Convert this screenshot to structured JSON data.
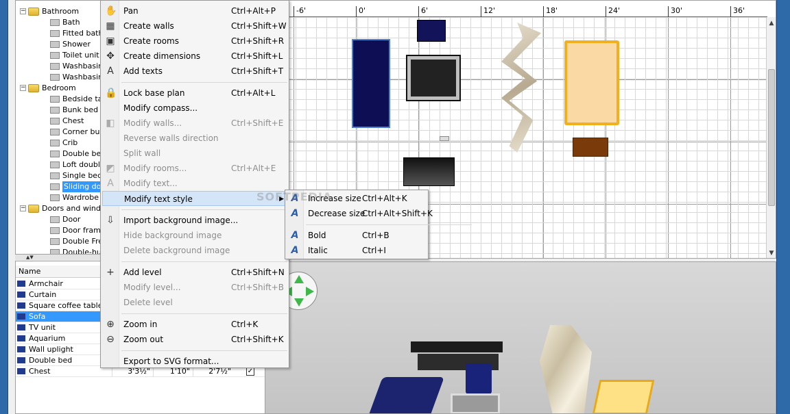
{
  "catalog": {
    "categories": [
      {
        "label": "Bathroom",
        "toggle": "−",
        "items": [
          "Bath",
          "Fitted bath",
          "Shower",
          "Toilet unit",
          "Washbasin",
          "Washbasin"
        ]
      },
      {
        "label": "Bedroom",
        "toggle": "−",
        "items": [
          "Bedside tab",
          "Bunk bed",
          "Chest",
          "Corner bun",
          "Crib",
          "Double bed",
          "Loft double",
          "Single bed",
          "Sliding door",
          "Wardrobe"
        ]
      },
      {
        "label": "Doors and wind",
        "toggle": "−",
        "items": [
          "Door",
          "Door frame",
          "Double Fre",
          "Double-hun"
        ]
      }
    ],
    "selected_item": "Sliding door"
  },
  "splitter_arrows": "▲▼",
  "furniture": {
    "column_name": "Name",
    "rows": [
      {
        "name": "Armchair"
      },
      {
        "name": "Curtain"
      },
      {
        "name": "Square coffee table"
      },
      {
        "name": "Sofa",
        "selected": true
      },
      {
        "name": "TV unit"
      },
      {
        "name": "Aquarium"
      },
      {
        "name": "Wall uplight"
      },
      {
        "name": "Double bed"
      },
      {
        "name": "Chest",
        "width": "3'3½\"",
        "depth": "1'10\"",
        "height": "2'7½\"",
        "visible": "✓"
      }
    ]
  },
  "ruler": [
    "-6'",
    "0'",
    "6'",
    "12'",
    "18'",
    "24'",
    "30'",
    "36'"
  ],
  "scroll": {
    "up": "▲",
    "down": "▼"
  },
  "menu": {
    "items": [
      {
        "icon": "✋",
        "icon_name": "pan-hand-icon",
        "label": "Pan",
        "shortcut": "Ctrl+Alt+P",
        "disabled": false
      },
      {
        "icon": "▦",
        "icon_name": "create-walls-icon",
        "label": "Create walls",
        "shortcut": "Ctrl+Shift+W",
        "disabled": false
      },
      {
        "icon": "▣",
        "icon_name": "create-rooms-icon",
        "label": "Create rooms",
        "shortcut": "Ctrl+Shift+R",
        "disabled": false
      },
      {
        "icon": "✥",
        "icon_name": "create-dimensions-icon",
        "label": "Create dimensions",
        "shortcut": "Ctrl+Shift+L",
        "disabled": false
      },
      {
        "icon": "A",
        "icon_name": "add-text-icon",
        "label": "Add texts",
        "shortcut": "Ctrl+Shift+T",
        "disabled": false
      },
      {
        "sep": true
      },
      {
        "icon": "🔒",
        "icon_name": "lock-icon",
        "label": "Lock base plan",
        "shortcut": "Ctrl+Alt+L",
        "disabled": false
      },
      {
        "icon": "",
        "icon_name": "compass-icon",
        "label": "Modify compass...",
        "shortcut": "",
        "disabled": false
      },
      {
        "icon": "◧",
        "icon_name": "modify-walls-icon",
        "label": "Modify walls...",
        "shortcut": "Ctrl+Shift+E",
        "disabled": true
      },
      {
        "icon": "",
        "icon_name": "reverse-walls-icon",
        "label": "Reverse walls direction",
        "shortcut": "",
        "disabled": true
      },
      {
        "icon": "",
        "icon_name": "split-wall-icon",
        "label": "Split wall",
        "shortcut": "",
        "disabled": true
      },
      {
        "icon": "◩",
        "icon_name": "modify-rooms-icon",
        "label": "Modify rooms...",
        "shortcut": "Ctrl+Alt+E",
        "disabled": true
      },
      {
        "icon": "A",
        "icon_name": "modify-text-icon",
        "label": "Modify text...",
        "shortcut": "",
        "disabled": true
      },
      {
        "icon": "",
        "icon_name": "text-style-icon",
        "label": "Modify text style",
        "shortcut": "",
        "disabled": false,
        "highlight": true,
        "submenu_arrow": "▶"
      },
      {
        "sep": true
      },
      {
        "icon": "⇩",
        "icon_name": "import-background-icon",
        "label": "Import background image...",
        "shortcut": "",
        "disabled": false
      },
      {
        "icon": "",
        "icon_name": "hide-background-icon",
        "label": "Hide background image",
        "shortcut": "",
        "disabled": true
      },
      {
        "icon": "",
        "icon_name": "delete-background-icon",
        "label": "Delete background image",
        "shortcut": "",
        "disabled": true
      },
      {
        "sep": true
      },
      {
        "icon": "+",
        "icon_name": "add-level-icon",
        "label": "Add level",
        "shortcut": "Ctrl+Shift+N",
        "disabled": false
      },
      {
        "icon": "",
        "icon_name": "modify-level-icon",
        "label": "Modify level...",
        "shortcut": "Ctrl+Shift+B",
        "disabled": true
      },
      {
        "icon": "",
        "icon_name": "delete-level-icon",
        "label": "Delete level",
        "shortcut": "",
        "disabled": true
      },
      {
        "sep": true
      },
      {
        "icon": "⊕",
        "icon_name": "zoom-in-icon",
        "label": "Zoom in",
        "shortcut": "Ctrl+K",
        "disabled": false
      },
      {
        "icon": "⊖",
        "icon_name": "zoom-out-icon",
        "label": "Zoom out",
        "shortcut": "Ctrl+Shift+K",
        "disabled": false
      },
      {
        "sep": true
      },
      {
        "icon": "",
        "icon_name": "export-svg-icon",
        "label": "Export to SVG format...",
        "shortcut": "",
        "disabled": false
      }
    ]
  },
  "submenu": {
    "items": [
      {
        "icon": "A",
        "icon_name": "increase-size-icon",
        "label": "Increase size",
        "shortcut": "Ctrl+Alt+K"
      },
      {
        "icon": "A",
        "icon_name": "decrease-size-icon",
        "label": "Decrease size",
        "shortcut": "Ctrl+Alt+Shift+K"
      },
      {
        "sep": true
      },
      {
        "icon": "A",
        "icon_name": "bold-icon",
        "label": "Bold",
        "shortcut": "Ctrl+B"
      },
      {
        "icon": "A",
        "icon_name": "italic-icon",
        "label": "Italic",
        "shortcut": "Ctrl+I"
      }
    ]
  },
  "watermark": "SOFTPEDIA",
  "colors": {
    "selection": "#3399ff",
    "menu_highlight": "#d4e5f7",
    "frame": "#2e6aa8"
  }
}
